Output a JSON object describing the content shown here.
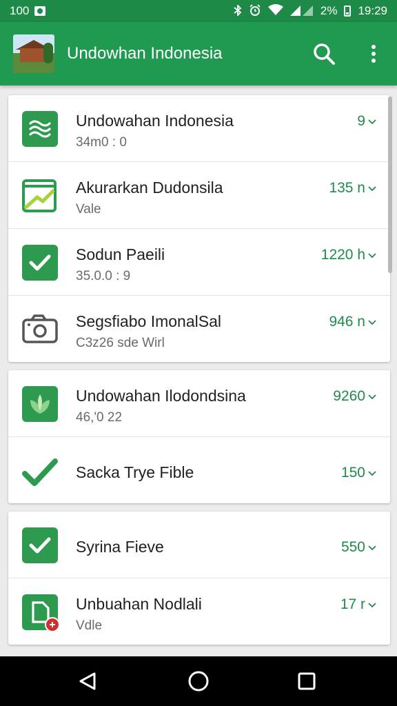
{
  "status_bar": {
    "left_text": "100",
    "battery": "2%",
    "time": "19:29",
    "icons": [
      "bluetooth-icon",
      "alarm-icon",
      "wifi-icon",
      "signal-icon",
      "battery-icon"
    ]
  },
  "app_bar": {
    "title": "Undowhan Indonesia",
    "actions": [
      "search-icon",
      "more-vert-icon"
    ]
  },
  "colors": {
    "status_bar": "#1e8a47",
    "app_bar": "#219a51",
    "accent": "#2e9a4f",
    "value_text": "#1f8a49",
    "nav_bar": "#000000"
  },
  "cards": [
    {
      "rows": [
        {
          "title": "Undowahan Indonesia",
          "subtitle": "34m0 : 0",
          "value": "9",
          "icon": "waves-icon"
        },
        {
          "title": "Akurarkan Dudonsila",
          "subtitle": "Vale",
          "value": "135 n",
          "icon": "chart-check-icon"
        },
        {
          "title": "Sodun Paeili",
          "subtitle": "35.0.0 : 9",
          "value": "1220 h",
          "icon": "checkbox-icon"
        },
        {
          "title": "Segsfiabo ImonalSal",
          "subtitle": "C3z26  sde Wirl",
          "value": "946 n",
          "icon": "camera-icon"
        }
      ]
    },
    {
      "rows": [
        {
          "title": "Undowahan Ilodondsina",
          "subtitle": "46,'0 22",
          "value": "9260",
          "icon": "leaf-icon"
        },
        {
          "title": "Sacka Trye Fible",
          "subtitle": "",
          "value": "150",
          "icon": "check-icon"
        }
      ]
    },
    {
      "rows": [
        {
          "title": "Syrina Fieve",
          "subtitle": "",
          "value": "550",
          "icon": "checkbox-icon"
        },
        {
          "title": "Unbuahan Nodlali",
          "subtitle": "Vdle",
          "value": "17 r",
          "icon": "document-badge-icon"
        }
      ]
    }
  ],
  "nav_bar": {
    "buttons": [
      "back-icon",
      "home-icon",
      "recent-apps-icon"
    ]
  }
}
